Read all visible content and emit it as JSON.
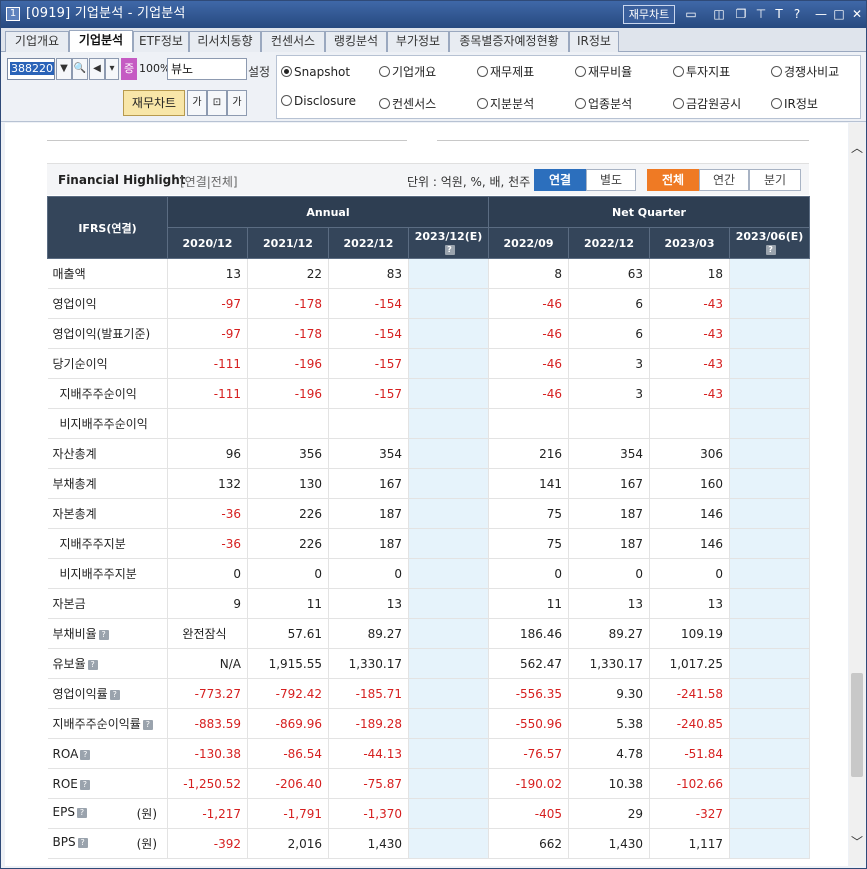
{
  "window": {
    "number": "1",
    "title": "[0919] 기업분석 - 기업분석",
    "fin_chart_button": "재무차트"
  },
  "tabs": [
    "기업개요",
    "기업분석",
    "ETF정보",
    "리서치동향",
    "컨센서스",
    "랭킹분석",
    "부가정보",
    "종목별증자예정현황",
    "IR정보"
  ],
  "toolbar": {
    "code": "388220",
    "jeung": "증",
    "ratio": "100%",
    "stock_name": "뷰노",
    "setting": "설정",
    "fin_chart": "재무차트"
  },
  "radios": [
    {
      "label": "Snapshot",
      "checked": true
    },
    {
      "label": "기업개요",
      "checked": false
    },
    {
      "label": "재무제표",
      "checked": false
    },
    {
      "label": "재무비율",
      "checked": false
    },
    {
      "label": "투자지표",
      "checked": false
    },
    {
      "label": "경쟁사비교",
      "checked": false
    },
    {
      "label": "Disclosure",
      "checked": false
    },
    {
      "label": "컨센서스",
      "checked": false
    },
    {
      "label": "지분분석",
      "checked": false
    },
    {
      "label": "업종분석",
      "checked": false
    },
    {
      "label": "금감원공시",
      "checked": false
    },
    {
      "label": "IR정보",
      "checked": false
    }
  ],
  "highlight": {
    "title": "Financial Highlight",
    "subtitle": "[연결|전체]",
    "unit": "단위 : 억원, %, 배, 천주",
    "seg_consol": "연결",
    "seg_separate": "별도",
    "seg_all": "전체",
    "seg_annual": "연간",
    "seg_quarter": "분기"
  },
  "table": {
    "corner": "IFRS(연결)",
    "annual_label": "Annual",
    "quarter_label": "Net Quarter",
    "annual_cols": [
      "2020/12",
      "2021/12",
      "2022/12",
      "2023/12(E)"
    ],
    "quarter_cols": [
      "2022/09",
      "2022/12",
      "2023/03",
      "2023/06(E)"
    ],
    "rows": [
      {
        "label": "매출액",
        "indent": false,
        "help": false,
        "unit": "",
        "values": [
          "13",
          "22",
          "83",
          "",
          "8",
          "63",
          "18",
          ""
        ]
      },
      {
        "label": "영업이익",
        "indent": false,
        "help": false,
        "unit": "",
        "values": [
          "-97",
          "-178",
          "-154",
          "",
          "-46",
          "6",
          "-43",
          ""
        ]
      },
      {
        "label": "영업이익(발표기준)",
        "indent": false,
        "help": false,
        "unit": "",
        "values": [
          "-97",
          "-178",
          "-154",
          "",
          "-46",
          "6",
          "-43",
          ""
        ]
      },
      {
        "label": "당기순이익",
        "indent": false,
        "help": false,
        "unit": "",
        "values": [
          "-111",
          "-196",
          "-157",
          "",
          "-46",
          "3",
          "-43",
          ""
        ]
      },
      {
        "label": "지배주주순이익",
        "indent": true,
        "help": false,
        "unit": "",
        "values": [
          "-111",
          "-196",
          "-157",
          "",
          "-46",
          "3",
          "-43",
          ""
        ]
      },
      {
        "label": "비지배주주순이익",
        "indent": true,
        "help": false,
        "unit": "",
        "values": [
          "",
          "",
          "",
          "",
          "",
          "",
          "",
          ""
        ]
      },
      {
        "label": "자산총계",
        "indent": false,
        "help": false,
        "unit": "",
        "values": [
          "96",
          "356",
          "354",
          "",
          "216",
          "354",
          "306",
          ""
        ]
      },
      {
        "label": "부채총계",
        "indent": false,
        "help": false,
        "unit": "",
        "values": [
          "132",
          "130",
          "167",
          "",
          "141",
          "167",
          "160",
          ""
        ]
      },
      {
        "label": "자본총계",
        "indent": false,
        "help": false,
        "unit": "",
        "values": [
          "-36",
          "226",
          "187",
          "",
          "75",
          "187",
          "146",
          ""
        ]
      },
      {
        "label": "지배주주지분",
        "indent": true,
        "help": false,
        "unit": "",
        "values": [
          "-36",
          "226",
          "187",
          "",
          "75",
          "187",
          "146",
          ""
        ]
      },
      {
        "label": "비지배주주지분",
        "indent": true,
        "help": false,
        "unit": "",
        "values": [
          "0",
          "0",
          "0",
          "",
          "0",
          "0",
          "0",
          ""
        ]
      },
      {
        "label": "자본금",
        "indent": false,
        "help": false,
        "unit": "",
        "values": [
          "9",
          "11",
          "13",
          "",
          "11",
          "13",
          "13",
          ""
        ]
      },
      {
        "label": "부채비율",
        "indent": false,
        "help": true,
        "unit": "",
        "values": [
          "완전잠식",
          "57.61",
          "89.27",
          "",
          "186.46",
          "89.27",
          "109.19",
          ""
        ]
      },
      {
        "label": "유보율",
        "indent": false,
        "help": true,
        "unit": "",
        "values": [
          "N/A",
          "1,915.55",
          "1,330.17",
          "",
          "562.47",
          "1,330.17",
          "1,017.25",
          ""
        ]
      },
      {
        "label": "영업이익률",
        "indent": false,
        "help": true,
        "unit": "",
        "values": [
          "-773.27",
          "-792.42",
          "-185.71",
          "",
          "-556.35",
          "9.30",
          "-241.58",
          ""
        ]
      },
      {
        "label": "지배주주순이익률",
        "indent": false,
        "help": true,
        "unit": "",
        "values": [
          "-883.59",
          "-869.96",
          "-189.28",
          "",
          "-550.96",
          "5.38",
          "-240.85",
          ""
        ]
      },
      {
        "label": "ROA",
        "indent": false,
        "help": true,
        "unit": "",
        "values": [
          "-130.38",
          "-86.54",
          "-44.13",
          "",
          "-76.57",
          "4.78",
          "-51.84",
          ""
        ]
      },
      {
        "label": "ROE",
        "indent": false,
        "help": true,
        "unit": "",
        "values": [
          "-1,250.52",
          "-206.40",
          "-75.87",
          "",
          "-190.02",
          "10.38",
          "-102.66",
          ""
        ]
      },
      {
        "label": "EPS",
        "indent": false,
        "help": true,
        "unit": "(원)",
        "values": [
          "-1,217",
          "-1,791",
          "-1,370",
          "",
          "-405",
          "29",
          "-327",
          ""
        ]
      },
      {
        "label": "BPS",
        "indent": false,
        "help": true,
        "unit": "(원)",
        "values": [
          "-392",
          "2,016",
          "1,430",
          "",
          "662",
          "1,430",
          "1,117",
          ""
        ]
      }
    ]
  }
}
